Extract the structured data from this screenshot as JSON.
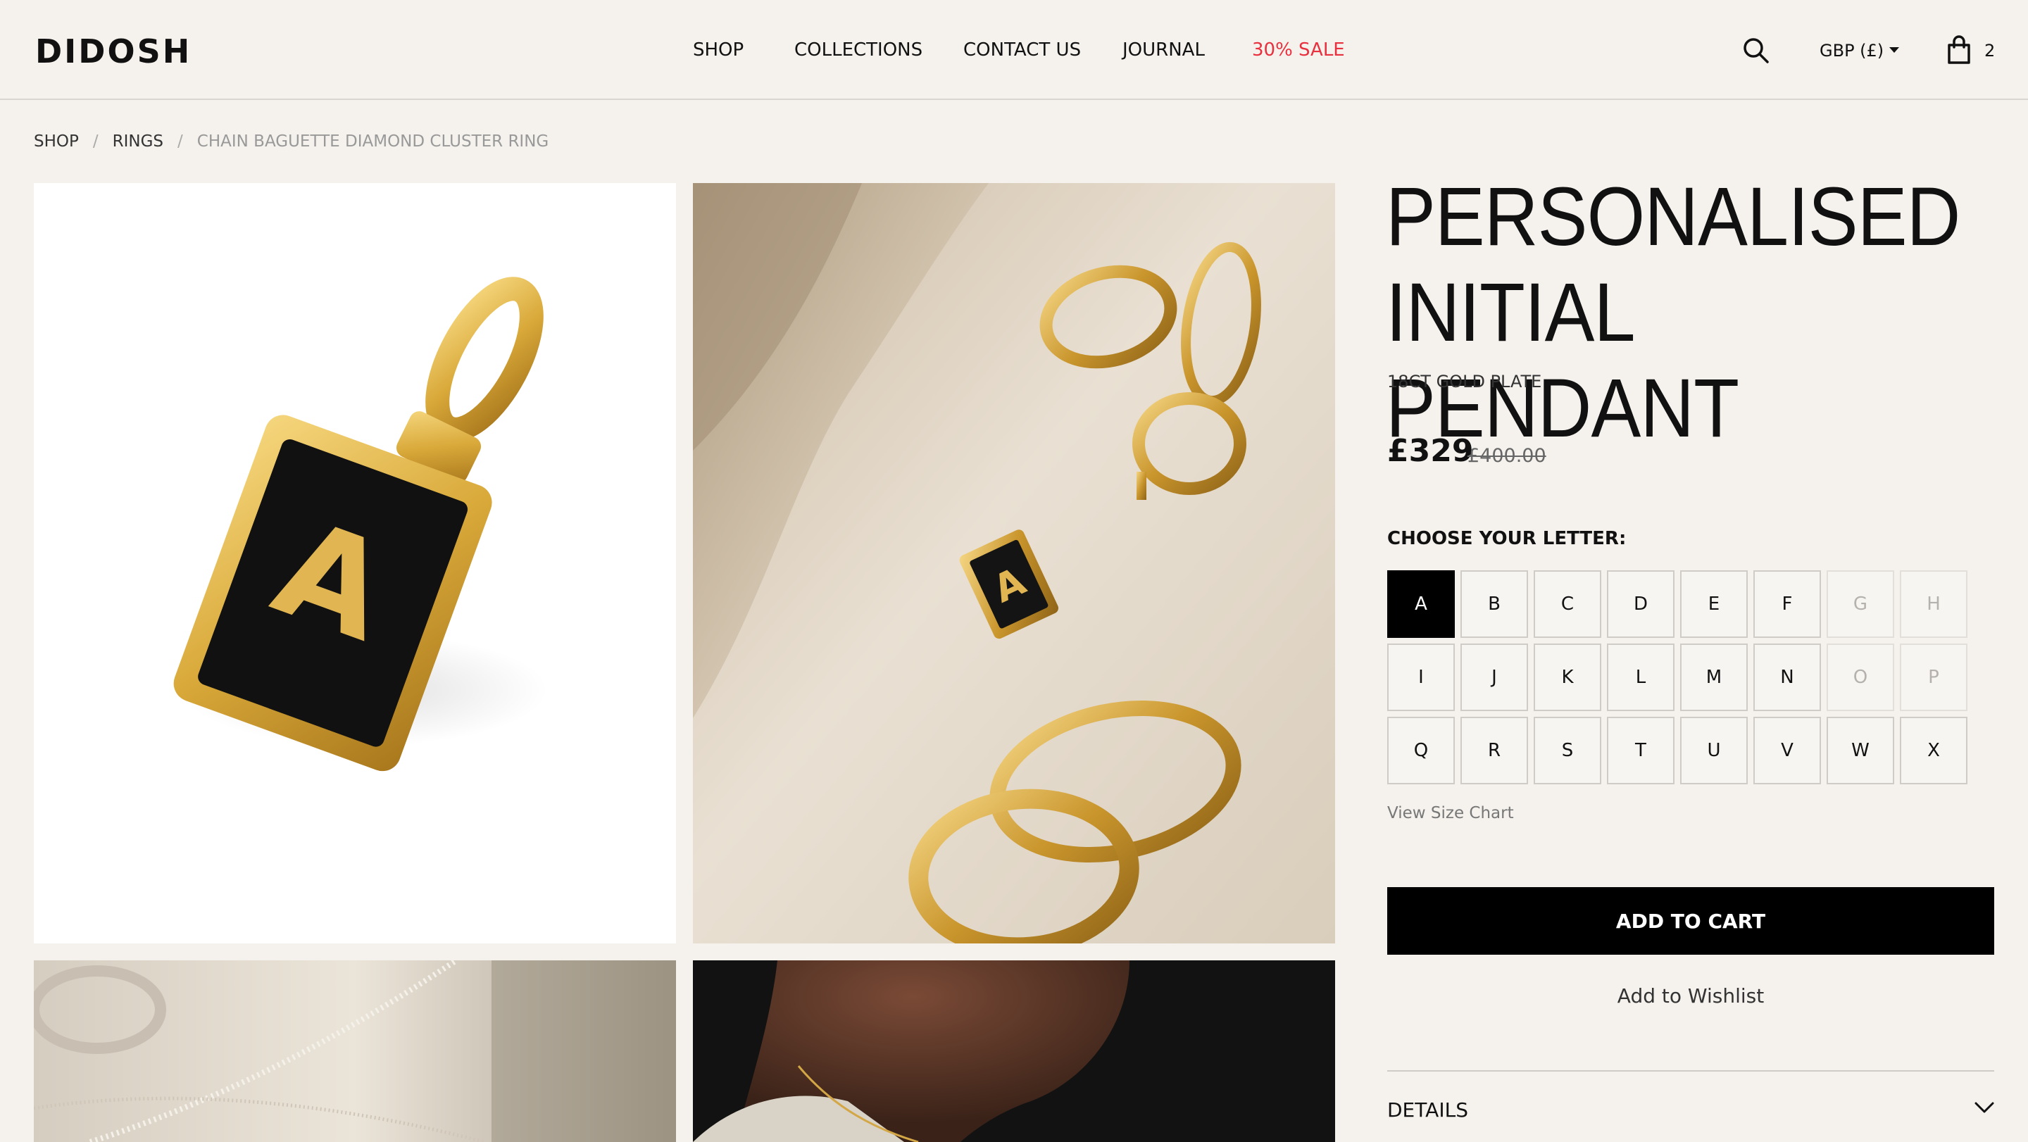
{
  "header": {
    "logo": "DIDOSH",
    "nav": [
      {
        "label": "SHOP",
        "name": "nav-shop"
      },
      {
        "label": "COLLECTIONS",
        "name": "nav-collections"
      },
      {
        "label": "CONTACT US",
        "name": "nav-contact-us"
      },
      {
        "label": "JOURNAL",
        "name": "nav-journal"
      },
      {
        "label": "30% SALE",
        "name": "nav-sale"
      }
    ],
    "currency": "GBP (£)",
    "cart_count": "2",
    "icons": {
      "search": "search-icon",
      "currency_caret": "caret-down-icon",
      "cart": "shopping-bag-icon"
    }
  },
  "breadcrumb": {
    "items": [
      "SHOP",
      "RINGS"
    ],
    "separator": "/",
    "current": "CHAIN BAGUETTE DIAMOND CLUSTER RING"
  },
  "product": {
    "title": "PERSONALISED INITIAL PENDANT",
    "subtitle": "18CT GOLD PLATE",
    "price": "£329",
    "old_price": "£400.00",
    "choose_label": "CHOOSE YOUR LETTER:",
    "letters": [
      {
        "label": "A",
        "state": "selected"
      },
      {
        "label": "B",
        "state": "available"
      },
      {
        "label": "C",
        "state": "available"
      },
      {
        "label": "D",
        "state": "available"
      },
      {
        "label": "E",
        "state": "available"
      },
      {
        "label": "F",
        "state": "available"
      },
      {
        "label": "G",
        "state": "disabled"
      },
      {
        "label": "H",
        "state": "disabled"
      },
      {
        "label": "I",
        "state": "available"
      },
      {
        "label": "J",
        "state": "available"
      },
      {
        "label": "K",
        "state": "available"
      },
      {
        "label": "L",
        "state": "available"
      },
      {
        "label": "M",
        "state": "available"
      },
      {
        "label": "N",
        "state": "available"
      },
      {
        "label": "O",
        "state": "disabled"
      },
      {
        "label": "P",
        "state": "disabled"
      },
      {
        "label": "Q",
        "state": "available"
      },
      {
        "label": "R",
        "state": "available"
      },
      {
        "label": "S",
        "state": "available"
      },
      {
        "label": "T",
        "state": "available"
      },
      {
        "label": "U",
        "state": "available"
      },
      {
        "label": "V",
        "state": "available"
      },
      {
        "label": "W",
        "state": "available"
      },
      {
        "label": "X",
        "state": "available"
      }
    ],
    "size_chart_label": "View Size Chart",
    "add_to_cart_label": "ADD TO CART",
    "wishlist_label": "Add to Wishlist",
    "details_label": "DETAILS"
  },
  "gallery": {
    "pendant_letter": "A",
    "images": [
      "pendant-product-image",
      "jewellery-flatlay-image",
      "necklace-detail-image",
      "model-wearing-image"
    ]
  },
  "colors": {
    "background": "#f5f2ee",
    "sale": "#e8313f",
    "button": "#000000",
    "gold": "#d9a93a"
  }
}
